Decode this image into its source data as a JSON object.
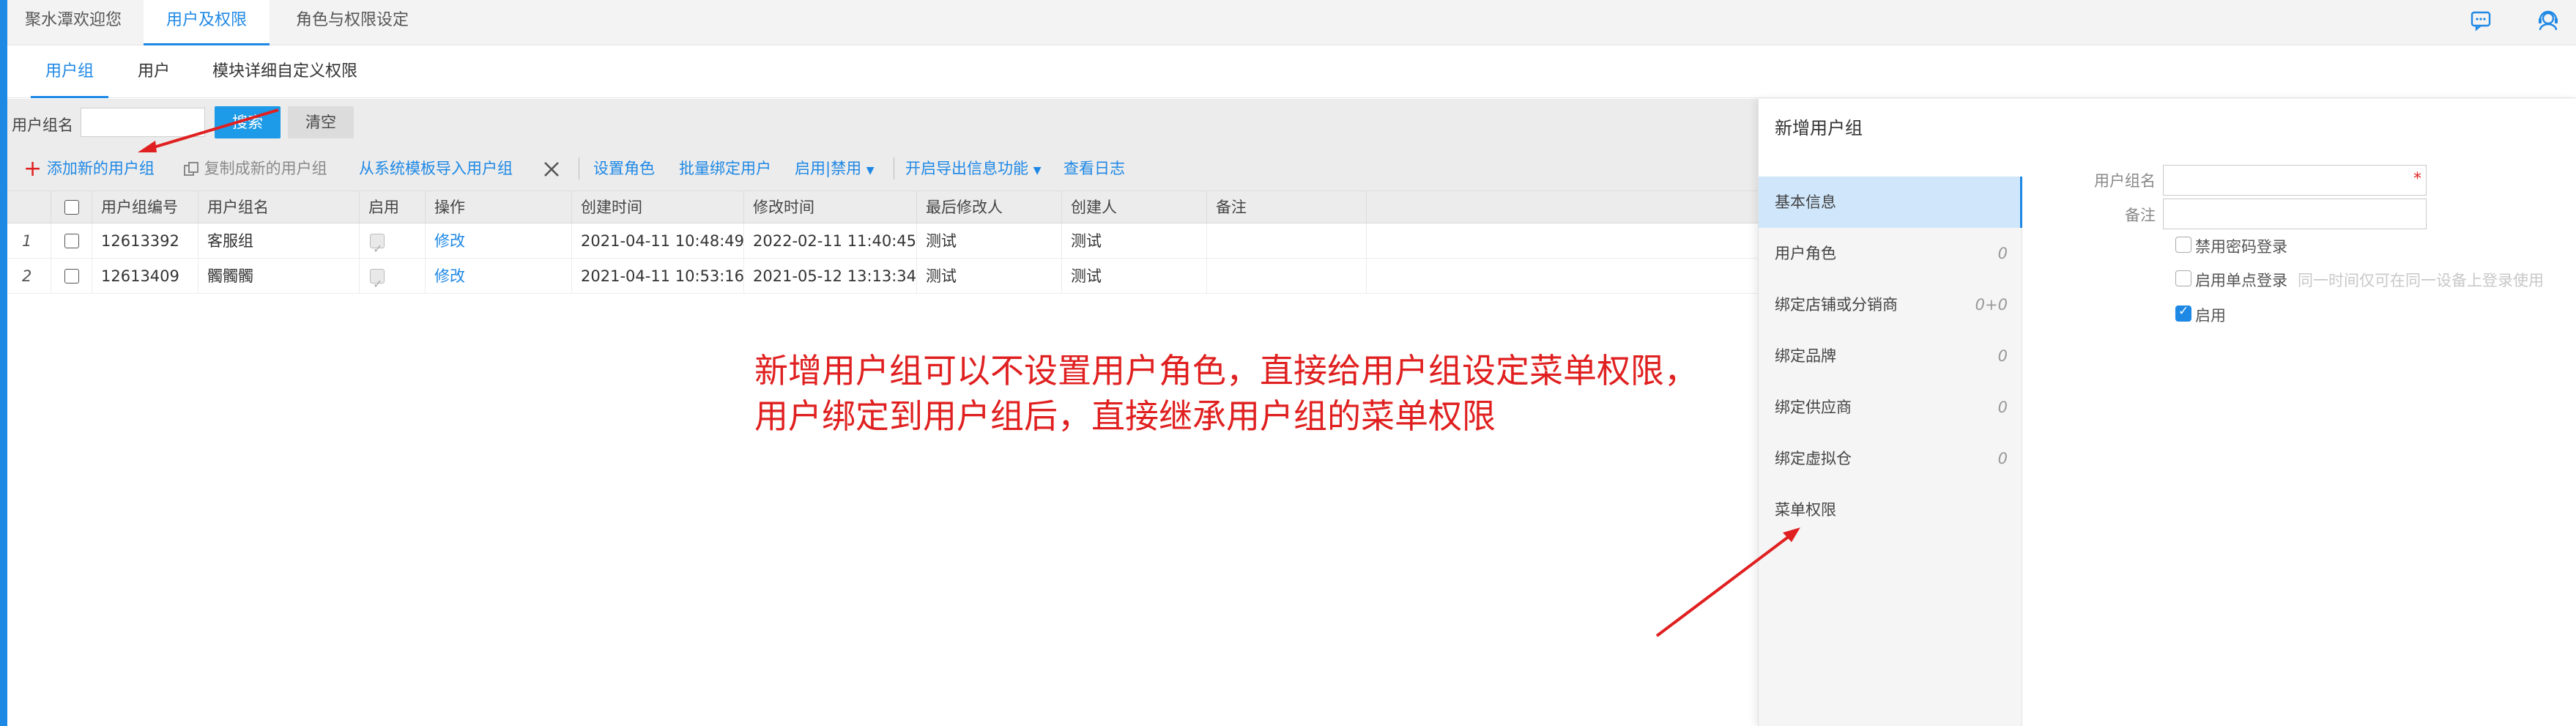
{
  "top_tabs": [
    "聚水潭欢迎您",
    "用户及权限",
    "角色与权限设定"
  ],
  "top_icons": [
    "chat-icon",
    "support-agent-icon"
  ],
  "sub_tabs": [
    "用户组",
    "用户",
    "模块详细自定义权限"
  ],
  "search": {
    "label": "用户组名",
    "value": "",
    "search_button": "搜索",
    "clear_button": "清空"
  },
  "toolbar": {
    "add": "添加新的用户组",
    "copy": "复制成新的用户组",
    "import": "从系统模板导入用户组",
    "set_role": "设置角色",
    "bind_users": "批量绑定用户",
    "enable_disable": "启用|禁用",
    "export": "开启导出信息功能",
    "log": "查看日志"
  },
  "table": {
    "columns": [
      "用户组编号",
      "用户组名",
      "启用",
      "操作",
      "创建时间",
      "修改时间",
      "最后修改人",
      "创建人",
      "备注"
    ],
    "rows": [
      {
        "index": "1",
        "id": "12613392",
        "name": "客服组",
        "enabled": true,
        "action": "修改",
        "created": "2021-04-11 10:48:49",
        "modified": "2022-02-11 11:40:45",
        "modifier": "测试",
        "creator": "测试",
        "remark": ""
      },
      {
        "index": "2",
        "id": "12613409",
        "name": "髑髑髑",
        "enabled": true,
        "action": "修改",
        "created": "2021-04-11 10:53:16",
        "modified": "2021-05-12 13:13:34",
        "modifier": "测试",
        "creator": "测试",
        "remark": ""
      }
    ]
  },
  "annotation": {
    "line1": "新增用户组可以不设置用户角色，直接给用户组设定菜单权限，",
    "line2": "用户绑定到用户组后，直接继承用户组的菜单权限"
  },
  "panel": {
    "title": "新增用户组",
    "nav": [
      {
        "label": "基本信息",
        "count": ""
      },
      {
        "label": "用户角色",
        "count": "0"
      },
      {
        "label": "绑定店铺或分销商",
        "count": "0+0"
      },
      {
        "label": "绑定品牌",
        "count": "0"
      },
      {
        "label": "绑定供应商",
        "count": "0"
      },
      {
        "label": "绑定虚拟仓",
        "count": "0"
      },
      {
        "label": "菜单权限",
        "count": ""
      }
    ],
    "form": {
      "name_label": "用户组名",
      "name_value": "",
      "remark_label": "备注",
      "remark_value": "",
      "opt_disable_pwd": "禁用密码登录",
      "opt_single_login": "启用单点登录",
      "opt_single_login_hint": "同一时间仅可在同一设备上登录使用",
      "opt_enable": "启用",
      "opt_enable_checked": true
    }
  },
  "colors": {
    "accent": "#1e88e5",
    "annotation": "#e02020"
  }
}
